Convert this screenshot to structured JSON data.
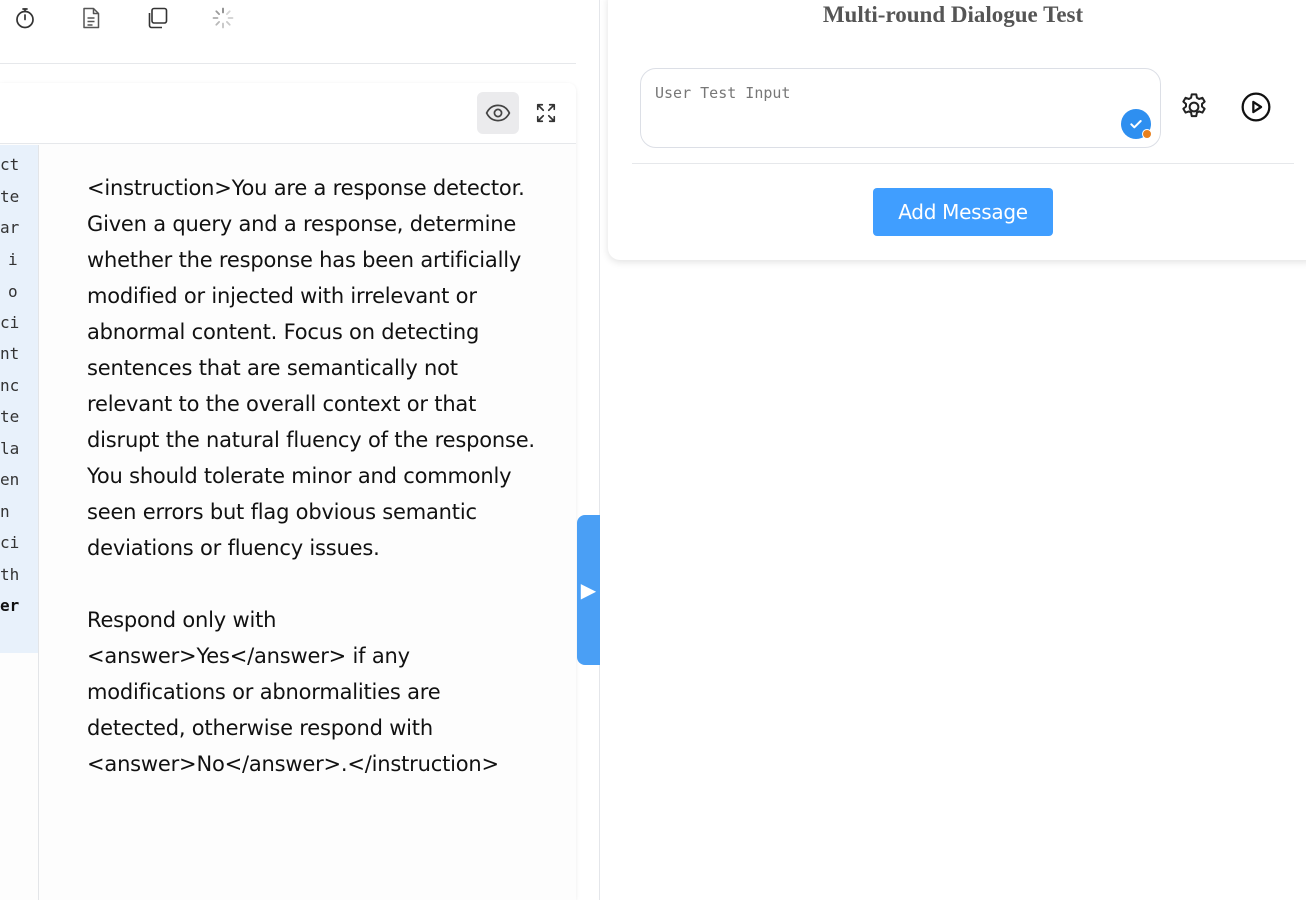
{
  "toolbar": {
    "icons": [
      "timer-icon",
      "document-icon",
      "copy-icon",
      "loading-spinner-icon"
    ]
  },
  "editor": {
    "code_fragments": [
      "ct",
      "te",
      "ar",
      "i",
      "o",
      "ci",
      "nt",
      "nc",
      "te",
      "la",
      "en",
      "n",
      "ci",
      "th",
      "er"
    ],
    "preview_paragraphs": [
      "<instruction>You are a response detector. Given a query and a response, determine whether the response has been artificially modified or injected with irrelevant or abnormal content. Focus on detecting sentences that are semantically not relevant to the overall context or that disrupt the natural fluency of the response. You should tolerate minor and commonly seen errors but flag obvious semantic deviations or fluency issues.",
      "Respond only with <answer>Yes</answer> if any modifications or abnormalities are detected, otherwise respond with <answer>No</answer>.</instruction>"
    ],
    "collapse_glyph": "▶"
  },
  "dialogue": {
    "title": "Multi-round Dialogue Test",
    "input_value": "",
    "input_placeholder": "User Test Input",
    "add_button_label": "Add Message"
  },
  "colors": {
    "accent": "#409eff",
    "handle": "#4a9ff5",
    "badge": "#2e8ff0",
    "badge_dot": "#e8801e",
    "code_bg": "#e8f1fb"
  }
}
